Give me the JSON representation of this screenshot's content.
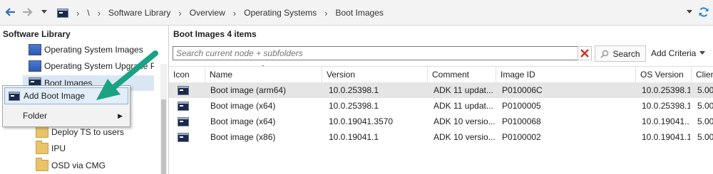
{
  "nav": {
    "breadcrumbs": [
      "\\",
      "Software Library",
      "Overview",
      "Operating Systems",
      "Boot Images"
    ]
  },
  "tree": {
    "title": "Software Library",
    "items": [
      {
        "label": "Operating System Images",
        "icon": "monitor-icon"
      },
      {
        "label": "Operating System Upgrade Pac",
        "icon": "monitor-icon"
      },
      {
        "label": "Boot Images",
        "icon": "cmd-icon"
      },
      {
        "label": "Deploy TS to users",
        "icon": "folder-icon"
      },
      {
        "label": "IPU",
        "icon": "folder-icon"
      },
      {
        "label": "OSD via CMG",
        "icon": "folder-icon"
      }
    ]
  },
  "context_menu": {
    "items": [
      {
        "label": "Add Boot Image",
        "icon": "cmd-icon"
      },
      {
        "label": "Folder",
        "submenu": true
      }
    ]
  },
  "main": {
    "title": "Boot Images 4 items",
    "search_placeholder": "Search current node + subfolders",
    "search_label": "Search",
    "add_criteria_label": "Add Criteria",
    "columns": [
      "Icon",
      "Name",
      "Version",
      "Comment",
      "Image ID",
      "OS Version",
      "Clien"
    ],
    "rows": [
      {
        "name": "Boot image (arm64)",
        "version": "10.0.25398.1",
        "comment": "ADK 11 updat...",
        "image_id": "P010006C",
        "os_version": "10.0.25398.1",
        "client": "5.00",
        "selected": true
      },
      {
        "name": "Boot image (x64)",
        "version": "10.0.25398.1",
        "comment": "ADK 11 updat...",
        "image_id": "P0100005",
        "os_version": "10.0.25398.1",
        "client": "5.00"
      },
      {
        "name": "Boot image (x64)",
        "version": "10.0.19041.3570",
        "comment": "ADK 10 versio...",
        "image_id": "P0100068",
        "os_version": "10.0.19041....",
        "client": "5.00"
      },
      {
        "name": "Boot image (x86)",
        "version": "10.0.19041.1",
        "comment": "ADK 10 versio...",
        "image_id": "P0100002",
        "os_version": "10.0.19041.1",
        "client": "5.00"
      }
    ]
  },
  "colors": {
    "arrow": "#19a383",
    "selection": "#e5e5e5",
    "tree_selection": "#d9e7f5"
  }
}
